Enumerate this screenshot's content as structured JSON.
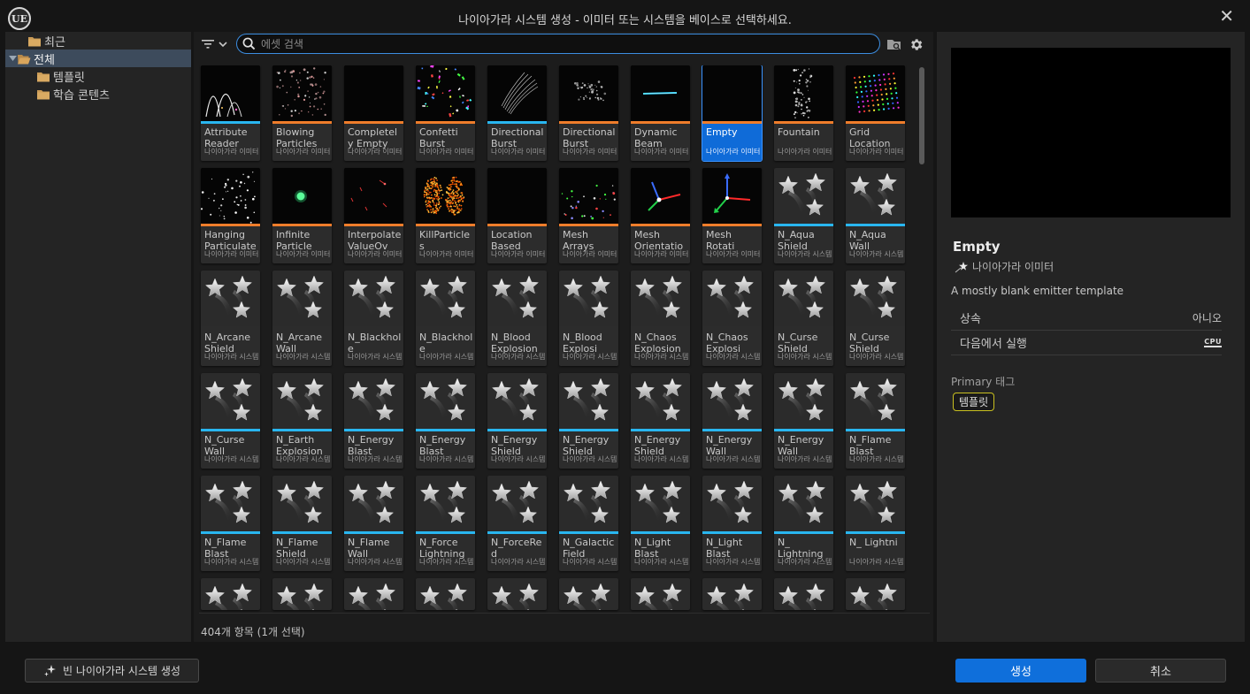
{
  "window": {
    "title": "나이아가라 시스템 생성 - 이미터 또는 시스템을 베이스로 선택하세요.",
    "logo": "UE"
  },
  "tree": {
    "items": [
      {
        "label": "최근",
        "level": 1,
        "expanded": false,
        "selected": false
      },
      {
        "label": "전체",
        "level": 0,
        "expanded": true,
        "selected": true
      },
      {
        "label": "템플릿",
        "level": 1,
        "expanded": false,
        "selected": false
      },
      {
        "label": "학습 콘텐츠",
        "level": 1,
        "expanded": false,
        "selected": false
      }
    ]
  },
  "search": {
    "placeholder": "에셋 검색",
    "value": ""
  },
  "colors": {
    "accent": "#0f6fdb",
    "system_bar": "#ef7d2b",
    "emitter_bar": "#29b6f0",
    "tag_border": "#c9c020"
  },
  "assets": [
    {
      "name": "Attribute Reader",
      "type": "나이아가라 이미터",
      "kind": "emitter",
      "thumb": "attr"
    },
    {
      "name": "Blowing Particles",
      "type": "나이아가라 이미터",
      "kind": "system",
      "thumb": "blow"
    },
    {
      "name": "Completely Empty",
      "type": "나이아가라 이미터",
      "kind": "system",
      "thumb": "none"
    },
    {
      "name": "Confetti Burst",
      "type": "나이아가라 이미터",
      "kind": "system",
      "thumb": "confetti"
    },
    {
      "name": "Directional Burst",
      "type": "나이아가라 이미터",
      "kind": "emitter",
      "thumb": "dirburst"
    },
    {
      "name": "Directional Burst",
      "type": "나이아가라 이미터",
      "kind": "system",
      "thumb": "dirburst2"
    },
    {
      "name": "Dynamic Beam",
      "type": "나이아가라 이미터",
      "kind": "system",
      "thumb": "beam"
    },
    {
      "name": "Empty",
      "type": "나이아가라 이미터",
      "kind": "system",
      "thumb": "none",
      "selected": true
    },
    {
      "name": "Fountain",
      "type": "나이아가라 이미터",
      "kind": "system",
      "thumb": "fountain"
    },
    {
      "name": "Grid Location",
      "type": "나이아가라 이미터",
      "kind": "system",
      "thumb": "grid"
    },
    {
      "name": "Hanging Particulates",
      "type": "나이아가라 이미터",
      "kind": "system",
      "thumb": "hanging"
    },
    {
      "name": "Infinite Particle",
      "type": "나이아가라 이미터",
      "kind": "system",
      "thumb": "infinite"
    },
    {
      "name": "Interpolate ValueOv",
      "type": "나이아가라 이미터",
      "kind": "system",
      "thumb": "interp"
    },
    {
      "name": "KillParticles",
      "type": "나이아가라 이미터",
      "kind": "system",
      "thumb": "kill"
    },
    {
      "name": "Location Based",
      "type": "나이아가라 이미터",
      "kind": "system",
      "thumb": "none"
    },
    {
      "name": "Mesh Arrays",
      "type": "나이아가라 이미터",
      "kind": "system",
      "thumb": "mesharr"
    },
    {
      "name": "Mesh Orientation",
      "type": "나이아가라 이미터",
      "kind": "system",
      "thumb": "axes"
    },
    {
      "name": "Mesh Rotati",
      "type": "나이아가라 이미터",
      "kind": "system",
      "thumb": "axes2"
    },
    {
      "name": "N_Aqua Shield",
      "type": "나이아가라 시스템",
      "kind": "emitter",
      "thumb": "stars"
    },
    {
      "name": "N_Aqua Wall",
      "type": "나이아가라 시스템",
      "kind": "emitter",
      "thumb": "stars"
    },
    {
      "name": "N_Arcane Shield",
      "type": "나이아가라 시스템",
      "kind": "none",
      "thumb": "stars"
    },
    {
      "name": "N_Arcane Wall",
      "type": "나이아가라 시스템",
      "kind": "none",
      "thumb": "stars"
    },
    {
      "name": "N_Blackhole Explosion",
      "type": "나이아가라 시스템",
      "kind": "none",
      "thumb": "stars"
    },
    {
      "name": "N_Blackhole Explosion",
      "type": "나이아가라 시스템",
      "kind": "none",
      "thumb": "stars"
    },
    {
      "name": "N_Blood Explosion",
      "type": "나이아가라 시스템",
      "kind": "none",
      "thumb": "stars"
    },
    {
      "name": "N_Blood Explosi",
      "type": "나이아가라 시스템",
      "kind": "none",
      "thumb": "stars"
    },
    {
      "name": "N_Chaos Explosion",
      "type": "나이아가라 시스템",
      "kind": "none",
      "thumb": "stars"
    },
    {
      "name": "N_Chaos Explosi",
      "type": "나이아가라 시스템",
      "kind": "none",
      "thumb": "stars"
    },
    {
      "name": "N_Curse Shield",
      "type": "나이아가라 시스템",
      "kind": "none",
      "thumb": "stars"
    },
    {
      "name": "N_Curse Shield",
      "type": "나이아가라 시스템",
      "kind": "none",
      "thumb": "stars"
    },
    {
      "name": "N_Curse Wall",
      "type": "나이아가라 시스템",
      "kind": "emitter",
      "thumb": "stars"
    },
    {
      "name": "N_Earth Explosion",
      "type": "나이아가라 시스템",
      "kind": "emitter",
      "thumb": "stars"
    },
    {
      "name": "N_Energy Blast",
      "type": "나이아가라 시스템",
      "kind": "emitter",
      "thumb": "stars"
    },
    {
      "name": "N_Energy Blast",
      "type": "나이아가라 시스템",
      "kind": "emitter",
      "thumb": "stars"
    },
    {
      "name": "N_Energy Shield",
      "type": "나이아가라 시스템",
      "kind": "emitter",
      "thumb": "stars"
    },
    {
      "name": "N_Energy Shield",
      "type": "나이아가라 시스템",
      "kind": "emitter",
      "thumb": "stars"
    },
    {
      "name": "N_Energy Shield",
      "type": "나이아가라 시스템",
      "kind": "emitter",
      "thumb": "stars"
    },
    {
      "name": "N_Energy Wall",
      "type": "나이아가라 시스템",
      "kind": "emitter",
      "thumb": "stars"
    },
    {
      "name": "N_Energy Wall",
      "type": "나이아가라 시스템",
      "kind": "emitter",
      "thumb": "stars"
    },
    {
      "name": "N_Flame Blast",
      "type": "나이아가라 시스템",
      "kind": "emitter",
      "thumb": "stars"
    },
    {
      "name": "N_Flame Blast",
      "type": "나이아가라 시스템",
      "kind": "emitter",
      "thumb": "stars"
    },
    {
      "name": "N_Flame Shield",
      "type": "나이아가라 시스템",
      "kind": "emitter",
      "thumb": "stars"
    },
    {
      "name": "N_Flame Wall",
      "type": "나이아가라 시스템",
      "kind": "emitter",
      "thumb": "stars"
    },
    {
      "name": "N_Force Lightning",
      "type": "나이아가라 시스템",
      "kind": "emitter",
      "thumb": "stars"
    },
    {
      "name": "N_ForceRed",
      "type": "나이아가라 시스템",
      "kind": "emitter",
      "thumb": "stars"
    },
    {
      "name": "N_Galactic Field",
      "type": "나이아가라 시스템",
      "kind": "emitter",
      "thumb": "stars"
    },
    {
      "name": "N_Light Blast",
      "type": "나이아가라 시스템",
      "kind": "emitter",
      "thumb": "stars"
    },
    {
      "name": "N_Light Blast",
      "type": "나이아가라 시스템",
      "kind": "emitter",
      "thumb": "stars"
    },
    {
      "name": "N_ Lightning",
      "type": "나이아가라 시스템",
      "kind": "emitter",
      "thumb": "stars"
    },
    {
      "name": "N_ Lightni",
      "type": "나이아가라 시스템",
      "kind": "emitter",
      "thumb": "stars"
    },
    {
      "name": "",
      "type": "",
      "kind": "none",
      "thumb": "stars",
      "partial": true
    },
    {
      "name": "",
      "type": "",
      "kind": "none",
      "thumb": "stars",
      "partial": true
    },
    {
      "name": "",
      "type": "",
      "kind": "none",
      "thumb": "stars",
      "partial": true
    },
    {
      "name": "",
      "type": "",
      "kind": "none",
      "thumb": "stars",
      "partial": true
    },
    {
      "name": "",
      "type": "",
      "kind": "none",
      "thumb": "stars",
      "partial": true
    },
    {
      "name": "",
      "type": "",
      "kind": "none",
      "thumb": "stars",
      "partial": true
    },
    {
      "name": "",
      "type": "",
      "kind": "none",
      "thumb": "stars",
      "partial": true
    },
    {
      "name": "",
      "type": "",
      "kind": "none",
      "thumb": "stars",
      "partial": true
    },
    {
      "name": "",
      "type": "",
      "kind": "none",
      "thumb": "stars",
      "partial": true
    },
    {
      "name": "",
      "type": "",
      "kind": "none",
      "thumb": "stars",
      "partial": true
    }
  ],
  "status": {
    "count": "404개 항목 (1개 선택)"
  },
  "details": {
    "title": "Empty",
    "type": "나이아가라 이미터",
    "description": "A mostly blank emitter template",
    "props": [
      {
        "label": "상속",
        "value": "아니오"
      },
      {
        "label": "다음에서 실행",
        "value": "CPU"
      }
    ],
    "tag_header": "Primary 태그",
    "tag": "템플릿"
  },
  "footer": {
    "empty_system": "빈 나이아가라 시스템 생성",
    "create": "생성",
    "cancel": "취소"
  }
}
